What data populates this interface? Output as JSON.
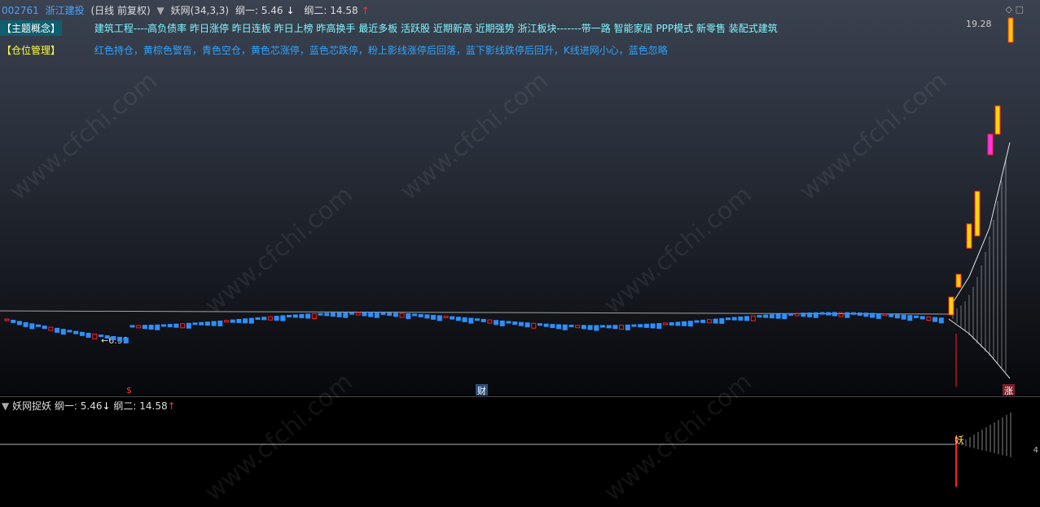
{
  "header": {
    "code": "002761",
    "name": "浙江建投",
    "period": "(日线 前复权)",
    "indicator": "妖网(34,3,3)",
    "gang1_label": "纲一: 5.46",
    "gang1_arrow": "↓",
    "gang2_label": "纲二: 14.58",
    "gang2_arrow": "↑"
  },
  "theme_row": {
    "tag": "【主题概念】",
    "text": "建筑工程----高负债率 昨日涨停 昨日连板 昨日上榜 昨高换手 最近多板 活跃股 近期新高 近期强势 浙江板块-------带一路 智能家居 PPP模式 新零售 装配式建筑"
  },
  "position_row": {
    "tag": "【仓位管理】",
    "text": "红色持仓，黄棕色警告，青色空仓，黄色芯涨停，蓝色芯跌停，粉上影线涨停后回落，蓝下影线跌停后回升，K线进网小心，蓝色忽略"
  },
  "price_labels": {
    "high": "19.28",
    "low": "6.99",
    "low_arrow": "←"
  },
  "markers": {
    "dollar": "$",
    "cai": "财",
    "zhang": "涨"
  },
  "sub_header": {
    "indicator": "妖网捉妖",
    "gang1_label": "纲一: 5.46",
    "gang1_arrow": "↓",
    "gang2_label": "纲二: 14.58",
    "gang2_arrow": "↑",
    "yao": "妖",
    "right_tick": "4"
  },
  "watermark": "www.cfchi.com",
  "colors": {
    "up_candle": "#ff2020",
    "down_candle": "#2e8fff",
    "limit_up_fill": "#ffd400",
    "accent_magenta": "#ff33ff",
    "net_line": "#e0e0e0"
  }
}
